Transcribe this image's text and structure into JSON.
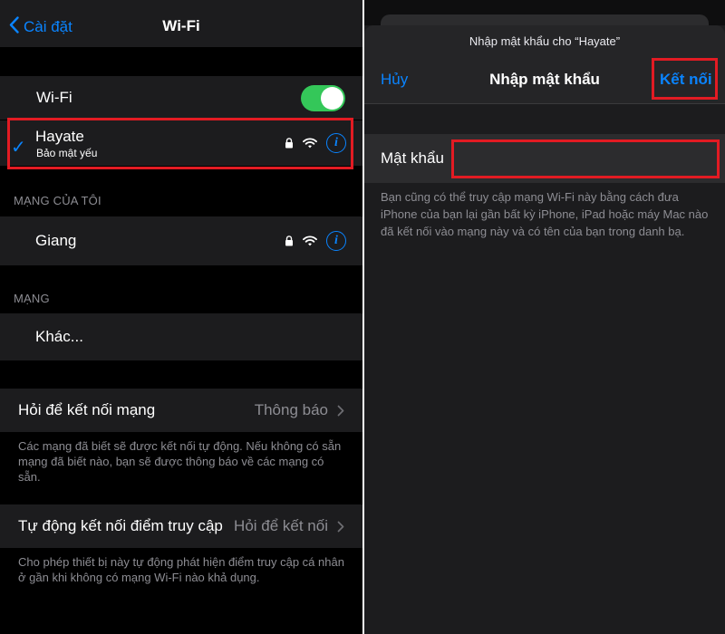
{
  "left": {
    "nav": {
      "back_label": "Cài đặt",
      "title": "Wi-Fi"
    },
    "wifi_toggle": {
      "label": "Wi-Fi",
      "state": "on"
    },
    "current_network": {
      "name": "Hayate",
      "subtitle": "Bảo mật yếu"
    },
    "my_networks": {
      "header": "MẠNG CỦA TÔI",
      "items": [
        {
          "name": "Giang"
        }
      ]
    },
    "networks": {
      "header": "MẠNG",
      "other_label": "Khác..."
    },
    "ask_to_join": {
      "label": "Hỏi để kết nối mạng",
      "value": "Thông báo",
      "footer": "Các mạng đã biết sẽ được kết nối tự động. Nếu không có sẵn mạng đã biết nào, bạn sẽ được thông báo về các mạng có sẵn."
    },
    "auto_join_hotspot": {
      "label": "Tự động kết nối điểm truy cập",
      "value": "Hỏi để kết nối",
      "footer": "Cho phép thiết bị này tự động phát hiện điểm truy cập cá nhân ở gần khi không có mạng Wi-Fi nào khả dụng."
    }
  },
  "right": {
    "prompt": "Nhập mật khẩu cho “Hayate”",
    "cancel_label": "Hủy",
    "title": "Nhập mật khẩu",
    "connect_label": "Kết nối",
    "password_label": "Mật khẩu",
    "password_value": "",
    "note": "Bạn cũng có thể truy cập mạng Wi-Fi này bằng cách đưa iPhone của bạn lại gần bất kỳ iPhone, iPad hoặc máy Mac nào đã kết nối vào mạng này và có tên của bạn trong danh bạ."
  },
  "colors": {
    "accent": "#0a84ff",
    "toggle_on": "#34c759",
    "highlight": "#e21b23",
    "background": "#000000",
    "cell": "#1c1c1e"
  },
  "icons": [
    "chevron-left-icon",
    "checkmark-icon",
    "lock-icon",
    "wifi-icon",
    "info-icon",
    "chevron-right-icon"
  ]
}
